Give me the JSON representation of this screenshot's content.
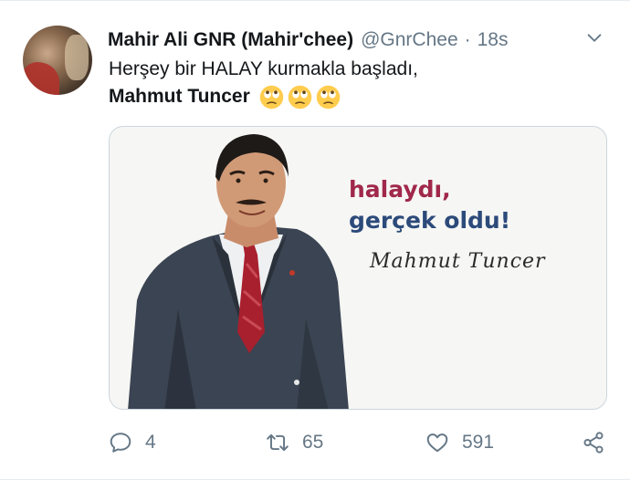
{
  "tweet": {
    "author_name": "Mahir Ali GNR (Mahir'chee)",
    "handle": "@GnrChee",
    "separator": "·",
    "time": "18s",
    "text_line1": "Herşey bir HALAY kurmakla başladı,",
    "text_line2": "Mahmut Tuncer",
    "emoji": [
      "face-with-rolling-eyes",
      "face-with-rolling-eyes",
      "face-with-rolling-eyes"
    ]
  },
  "media": {
    "quote_line1": "halaydı,",
    "quote_line2": "gerçek oldu!",
    "signature": "Mahmut Tuncer"
  },
  "actions": {
    "reply_count": "4",
    "retweet_count": "65",
    "like_count": "591"
  },
  "colors": {
    "muted": "#657786",
    "quote_red": "#a0284a",
    "quote_blue": "#2c4a7a"
  }
}
